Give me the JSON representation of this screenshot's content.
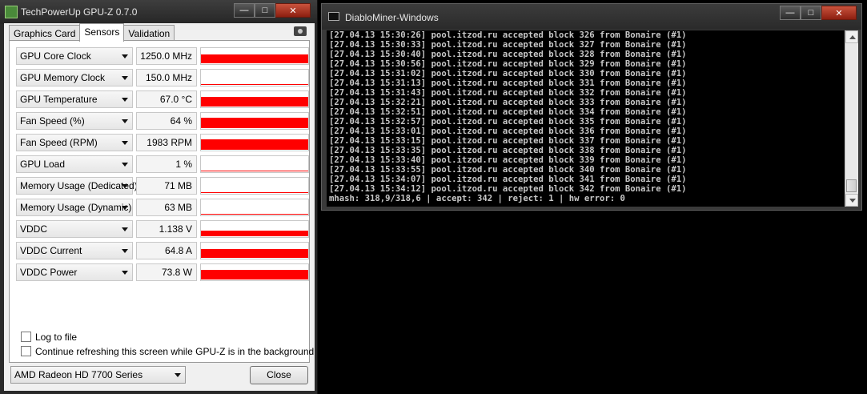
{
  "gpuz": {
    "title": "TechPowerUp GPU-Z 0.7.0",
    "tabs": [
      {
        "label": "Graphics Card",
        "active": false
      },
      {
        "label": "Sensors",
        "active": true
      },
      {
        "label": "Validation",
        "active": false
      }
    ],
    "sensors": [
      {
        "label": "GPU Core Clock",
        "value": "1250.0 MHz",
        "level": 0.55
      },
      {
        "label": "GPU Memory Clock",
        "value": "150.0 MHz",
        "level": 0.05
      },
      {
        "label": "GPU Temperature",
        "value": "67.0 °C",
        "level": 0.6
      },
      {
        "label": "Fan Speed (%)",
        "value": "64 %",
        "level": 0.64
      },
      {
        "label": "Fan Speed (RPM)",
        "value": "1983 RPM",
        "level": 0.64
      },
      {
        "label": "GPU Load",
        "value": "1 %",
        "level": 0.01
      },
      {
        "label": "Memory Usage (Dedicated)",
        "value": "71 MB",
        "level": 0.05
      },
      {
        "label": "Memory Usage (Dynamic)",
        "value": "63 MB",
        "level": 0.04
      },
      {
        "label": "VDDC",
        "value": "1.138 V",
        "level": 0.35
      },
      {
        "label": "VDDC Current",
        "value": "64.8 A",
        "level": 0.55
      },
      {
        "label": "VDDC Power",
        "value": "73.8 W",
        "level": 0.6
      }
    ],
    "options": {
      "log_to_file": "Log to file",
      "continue_refresh": "Continue refreshing this screen while GPU-Z is in the background"
    },
    "gpu_select": "AMD Radeon HD 7700 Series",
    "close_label": "Close",
    "colors": {
      "graph": "#ff0000"
    }
  },
  "console": {
    "title": "DiabloMiner-Windows",
    "lines": [
      "[27.04.13 15:30:26] pool.itzod.ru accepted block 326 from Bonaire (#1)",
      "[27.04.13 15:30:33] pool.itzod.ru accepted block 327 from Bonaire (#1)",
      "[27.04.13 15:30:40] pool.itzod.ru accepted block 328 from Bonaire (#1)",
      "[27.04.13 15:30:56] pool.itzod.ru accepted block 329 from Bonaire (#1)",
      "[27.04.13 15:31:02] pool.itzod.ru accepted block 330 from Bonaire (#1)",
      "[27.04.13 15:31:13] pool.itzod.ru accepted block 331 from Bonaire (#1)",
      "[27.04.13 15:31:43] pool.itzod.ru accepted block 332 from Bonaire (#1)",
      "[27.04.13 15:32:21] pool.itzod.ru accepted block 333 from Bonaire (#1)",
      "[27.04.13 15:32:51] pool.itzod.ru accepted block 334 from Bonaire (#1)",
      "[27.04.13 15:32:57] pool.itzod.ru accepted block 335 from Bonaire (#1)",
      "[27.04.13 15:33:01] pool.itzod.ru accepted block 336 from Bonaire (#1)",
      "[27.04.13 15:33:15] pool.itzod.ru accepted block 337 from Bonaire (#1)",
      "[27.04.13 15:33:35] pool.itzod.ru accepted block 338 from Bonaire (#1)",
      "[27.04.13 15:33:40] pool.itzod.ru accepted block 339 from Bonaire (#1)",
      "[27.04.13 15:33:55] pool.itzod.ru accepted block 340 from Bonaire (#1)",
      "[27.04.13 15:34:07] pool.itzod.ru accepted block 341 from Bonaire (#1)",
      "[27.04.13 15:34:12] pool.itzod.ru accepted block 342 from Bonaire (#1)"
    ],
    "status": "mhash: 318,9/318,6 | accept: 342 | reject: 1 | hw error: 0"
  }
}
